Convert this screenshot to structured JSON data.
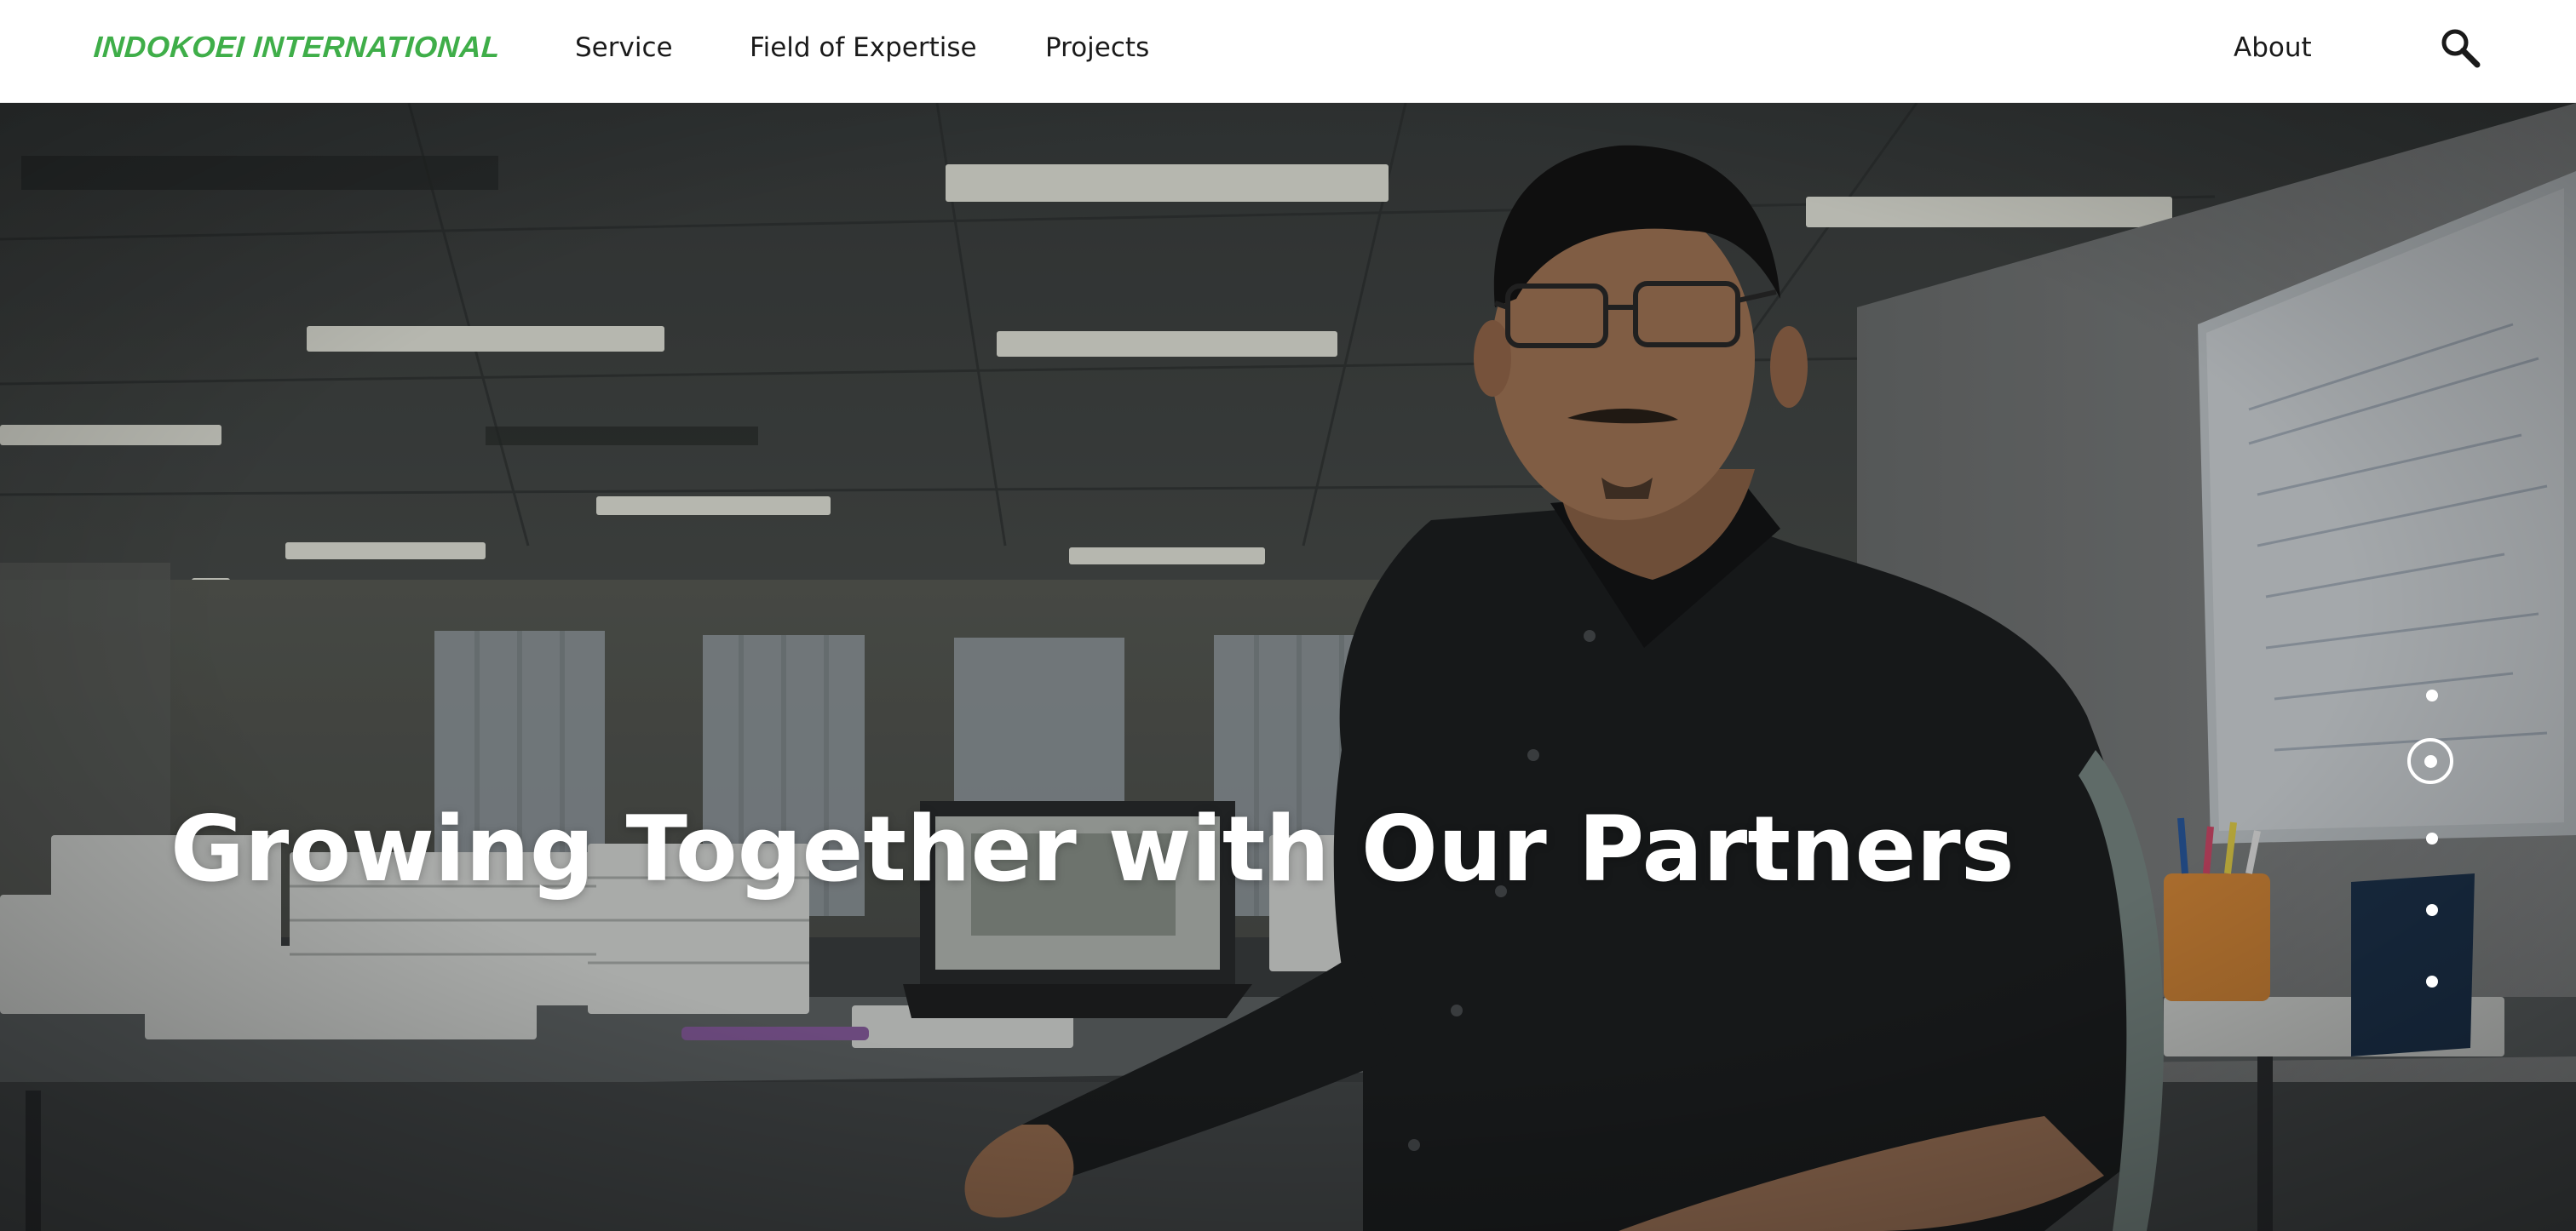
{
  "header": {
    "logo": "INDOKOEI INTERNATIONAL",
    "nav": {
      "service": "Service",
      "field_of_expertise": "Field of Expertise",
      "projects": "Projects",
      "about": "About"
    },
    "search_icon": "search-icon"
  },
  "hero": {
    "title": "Growing Together with Our Partners",
    "slides_total": 5,
    "active_slide": 2
  },
  "colors": {
    "brand_green": "#3fae49",
    "nav_text": "#1a1a1a",
    "hero_text": "#ffffff"
  }
}
